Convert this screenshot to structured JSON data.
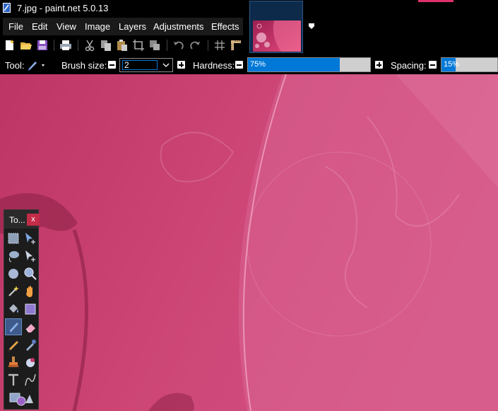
{
  "window": {
    "title": "7.jpg - paint.net 5.0.13"
  },
  "menu": {
    "items": [
      "File",
      "Edit",
      "View",
      "Image",
      "Layers",
      "Adjustments",
      "Effects"
    ]
  },
  "toolbar": {
    "icons": [
      "new-icon",
      "open-icon",
      "save-icon",
      "print-icon",
      "cut-icon",
      "copy-icon",
      "paste-icon",
      "crop-icon",
      "deselect-icon",
      "undo-icon",
      "redo-icon",
      "grid-icon",
      "ruler-icon"
    ]
  },
  "options": {
    "tool_label": "Tool:",
    "brush_size_label": "Brush size:",
    "brush_size_value": "2",
    "hardness_label": "Hardness:",
    "hardness_value": "75%",
    "hardness_fraction": 0.75,
    "spacing_label": "Spacing:",
    "spacing_value": "15%",
    "spacing_fraction": 0.15
  },
  "toolbox": {
    "title": "To...",
    "close_label": "x",
    "tools": [
      "rectangle-select",
      "move-selection",
      "lasso-select",
      "move-selection-outline",
      "ellipse-select",
      "zoom",
      "magic-wand",
      "pan",
      "paint-bucket",
      "gradient",
      "paintbrush",
      "eraser",
      "pencil",
      "color-picker",
      "clone-stamp",
      "recolor",
      "text",
      "line-curve",
      "shapes"
    ],
    "active_tool": "paintbrush"
  },
  "colors": {
    "accent": "#0078d7",
    "close": "#c42b46",
    "canvas": "#c9406e"
  }
}
